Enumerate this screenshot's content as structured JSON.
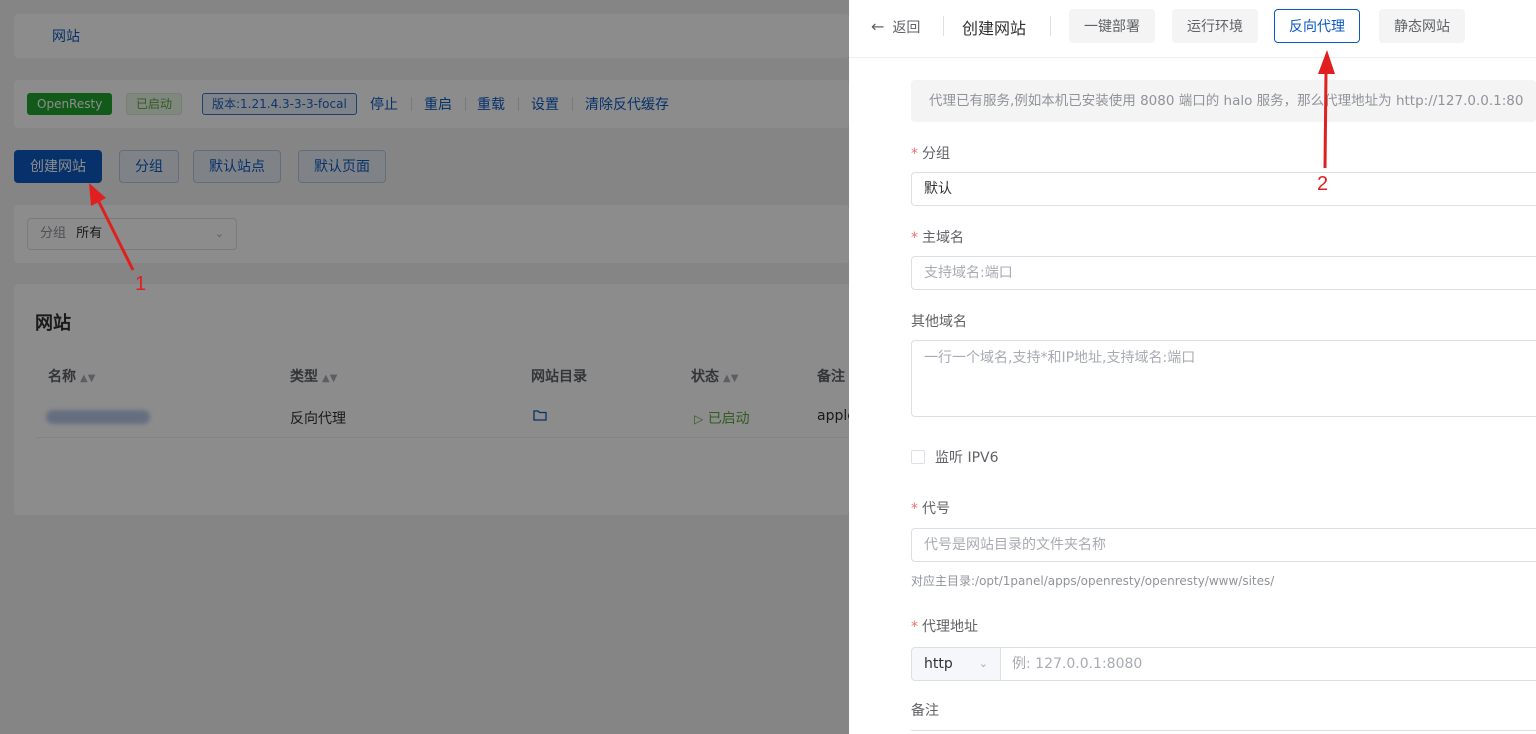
{
  "background": {
    "breadcrumb": "网站",
    "status_bar": {
      "app_tag": "OpenResty",
      "state_tag": "已启动",
      "version_tag": "版本:1.21.4.3-3-3-focal",
      "actions": [
        "停止",
        "重启",
        "重载",
        "设置",
        "清除反代缓存"
      ]
    },
    "toolbar": {
      "create": "创建网站",
      "group": "分组",
      "default_site": "默认站点",
      "default_page": "默认页面"
    },
    "filter": {
      "label": "分组",
      "value": "所有"
    },
    "table": {
      "title": "网站",
      "headers": [
        "名称",
        "类型",
        "网站目录",
        "状态",
        "备注"
      ],
      "row": {
        "type": "反向代理",
        "status": "已启动",
        "remark": "apple"
      }
    }
  },
  "annotations": {
    "one": "1",
    "two": "2"
  },
  "drawer": {
    "back": "返回",
    "title": "创建网站",
    "tabs": [
      "一键部署",
      "运行环境",
      "反向代理",
      "静态网站"
    ],
    "active_tab": "反向代理",
    "info": "代理已有服务,例如本机已安装使用 8080 端口的 halo 服务，那么代理地址为 http://127.0.0.1:80",
    "form": {
      "group_label": "分组",
      "group_value": "默认",
      "domain_label": "主域名",
      "domain_placeholder": "支持域名:端口",
      "other_label": "其他域名",
      "other_placeholder": "一行一个域名,支持*和IP地址,支持域名:端口",
      "ipv6_label": "监听 IPV6",
      "alias_label": "代号",
      "alias_placeholder": "代号是网站目录的文件夹名称",
      "alias_hint": "对应主目录:/opt/1panel/apps/openresty/openresty/www/sites/",
      "proxy_label": "代理地址",
      "proxy_protocol": "http",
      "proxy_placeholder": "例: 127.0.0.1:8080",
      "remark_label": "备注"
    }
  }
}
